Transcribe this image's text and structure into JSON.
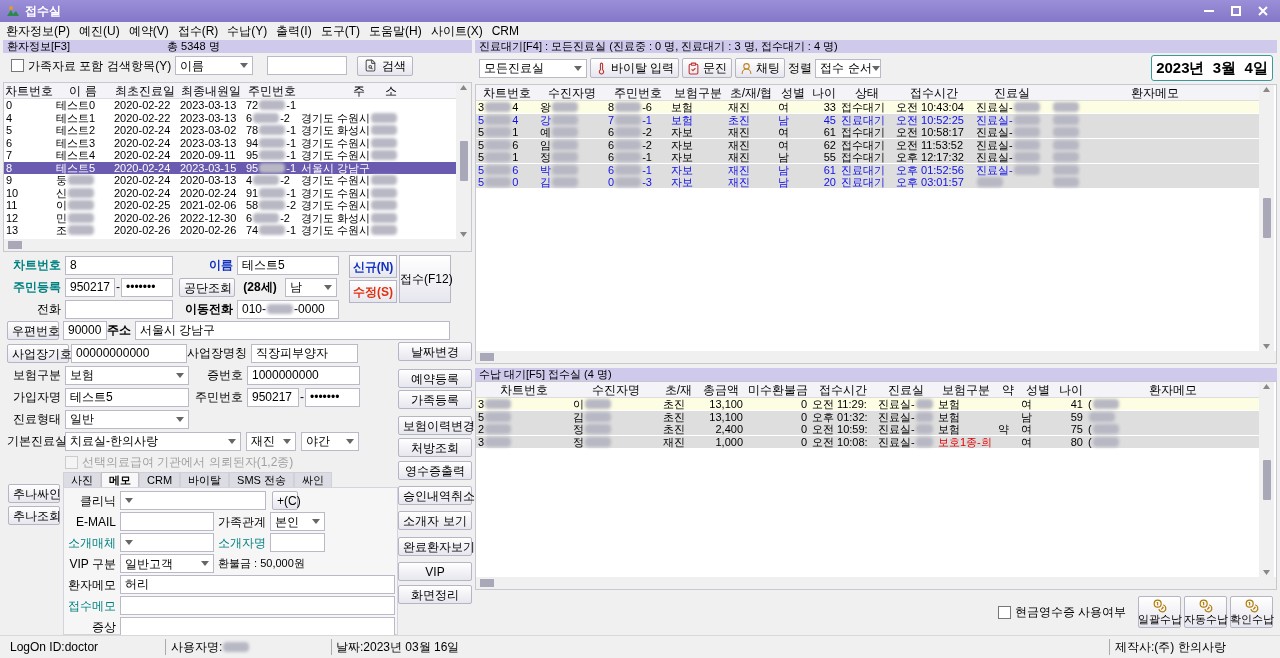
{
  "window": {
    "title": "접수실"
  },
  "menu": [
    "환자정보(P)",
    "예진(U)",
    "예약(V)",
    "접수(R)",
    "수납(Y)",
    "출력(I)",
    "도구(T)",
    "도움말(H)",
    "사이트(X)",
    "CRM"
  ],
  "patients": {
    "title": "환자정보[F3]",
    "total": "총 5348 명",
    "family_checkbox": {
      "label": "가족자료 포함",
      "checked": false
    },
    "search_label": "검색항목(Y)",
    "search_field": "이름",
    "search_button": "검색",
    "columns": [
      "차트번호",
      "이 름",
      "최초진료일",
      "최종내원일",
      "주민번호",
      "주      소"
    ],
    "rows": [
      {
        "cells": [
          "0",
          "테스트0",
          "2020-02-22",
          "2023-03-13",
          [
            "72",
            {
              "kind": "blur"
            },
            "-1"
          ]
        ],
        "selected": false
      },
      {
        "cells": [
          "4",
          "테스트1",
          "2020-02-22",
          "2023-03-13",
          [
            "6",
            {
              "kind": "blur"
            },
            "-2"
          ],
          [
            "경기도 수원시",
            {
              "kind": "blur"
            }
          ]
        ],
        "selected": false
      },
      {
        "cells": [
          "5",
          "테스트2",
          "2020-02-24",
          "2023-03-02",
          [
            "78",
            {
              "kind": "blur"
            },
            "-1"
          ],
          [
            "경기도 화성시",
            {
              "kind": "blur"
            }
          ]
        ],
        "selected": false
      },
      {
        "cells": [
          "6",
          "테스트3",
          "2020-02-24",
          "2023-03-13",
          [
            "94",
            {
              "kind": "blur"
            },
            "-1"
          ],
          [
            "경기도 수원시",
            {
              "kind": "blur"
            }
          ]
        ],
        "selected": false
      },
      {
        "cells": [
          "7",
          "테스트4",
          "2020-02-24",
          "2020-09-11",
          [
            "95",
            {
              "kind": "blur"
            },
            "-1"
          ],
          [
            "경기도 수원시",
            {
              "kind": "blur"
            }
          ]
        ],
        "selected": false
      },
      {
        "cells": [
          "8",
          "테스트5",
          "2020-02-24",
          "2023-03-15",
          [
            "95",
            {
              "kind": "blur"
            },
            "-1"
          ],
          "서울시 강남구"
        ],
        "selected": true
      },
      {
        "cells": [
          "9",
          [
            "둥",
            {
              "kind": "blur"
            }
          ],
          "2020-02-24",
          "2020-03-13",
          [
            "4",
            {
              "kind": "blur"
            },
            "-2"
          ],
          [
            "경기도 수원시",
            {
              "kind": "blur"
            }
          ]
        ],
        "selected": false
      },
      {
        "cells": [
          "10",
          [
            "신",
            {
              "kind": "blur"
            }
          ],
          "2020-02-24",
          "2020-02-24",
          [
            "91",
            {
              "kind": "blur"
            },
            "-1"
          ],
          [
            "경기도 수원시",
            {
              "kind": "blur"
            }
          ]
        ],
        "selected": false
      },
      {
        "cells": [
          "11",
          [
            "이",
            {
              "kind": "blur"
            }
          ],
          "2020-02-25",
          "2021-02-06",
          [
            "58",
            {
              "kind": "blur"
            },
            "-2"
          ],
          [
            "경기도 수원시",
            {
              "kind": "blur"
            }
          ]
        ],
        "selected": false
      },
      {
        "cells": [
          "12",
          [
            "민",
            {
              "kind": "blur"
            }
          ],
          "2020-02-26",
          "2022-12-30",
          [
            "6",
            {
              "kind": "blur"
            },
            "-2"
          ],
          [
            "경기도 화성시",
            {
              "kind": "blur"
            }
          ]
        ],
        "selected": false
      },
      {
        "cells": [
          "13",
          [
            "조",
            {
              "kind": "blur"
            }
          ],
          "2020-02-26",
          "2020-02-26",
          [
            "74",
            {
              "kind": "blur"
            },
            "-1"
          ],
          [
            "경기도 수원시",
            {
              "kind": "blur"
            }
          ]
        ],
        "selected": false
      }
    ]
  },
  "form": {
    "chart_no": {
      "label": "차트번호",
      "value": "8"
    },
    "name": {
      "label": "이름",
      "value": "테스트5"
    },
    "new_button": "신규(N)",
    "edit_button": "수정(S)",
    "register_button": "접수(F12)",
    "rrn": {
      "label": "주민등록",
      "front": "950217",
      "separator": "-",
      "back": "•••••••"
    },
    "nhis_button": "공단조회",
    "age": "(28세)",
    "sex": "남",
    "phone": {
      "label": "전화"
    },
    "mobile": {
      "label": "이동전화",
      "value": [
        "010-",
        {
          "kind": "blur"
        },
        "-0000"
      ]
    },
    "zip_button": "우편번호",
    "zip": "90000",
    "address": {
      "label": "주소",
      "value": "서울시 강남구"
    },
    "workplace_button": "사업장기호",
    "workplace_no": "00000000000",
    "workplace_name": {
      "label": "사업장명칭",
      "value": "직장피부양자"
    },
    "insurance": {
      "label": "보험구분",
      "value": "보험"
    },
    "card_no": {
      "label": "증번호",
      "value": "1000000000"
    },
    "subscriber": {
      "label": "가입자명",
      "value": "테스트5"
    },
    "subscriber_rrn": {
      "label": "주민번호",
      "front": "950217",
      "separator": "-",
      "back": "•••••••"
    },
    "care_type": {
      "label": "진료형태",
      "value": "일반"
    },
    "room": {
      "label": "기본진료실",
      "value": "치료실-한의사랑",
      "visit": "재진",
      "time": "야간"
    },
    "referral_check": {
      "label": "선택의료급여 기관에서 의뢰된자(1,2종)",
      "checked": false,
      "disabled": true
    },
    "tabs": [
      {
        "label": "사진",
        "selected": false
      },
      {
        "label": "메모",
        "selected": true
      },
      {
        "label": "CRM",
        "selected": false
      },
      {
        "label": "바이탈",
        "selected": false
      },
      {
        "label": "SMS 전송",
        "selected": false
      },
      {
        "label": "싸인",
        "selected": false
      }
    ],
    "side_buttons": [
      "추나싸인",
      "추나조회"
    ],
    "memo": {
      "clinic": {
        "label": "클리닉"
      },
      "clinic_add": "+(C)",
      "email": {
        "label": "E-MAIL"
      },
      "family": {
        "label": "가족관계",
        "value": "본인"
      },
      "media": {
        "label": "소개매체"
      },
      "referrer": {
        "label": "소개자명"
      },
      "vip": {
        "label": "VIP 구분",
        "value": "일반고객"
      },
      "refund": "환불금 : 50,000원",
      "patient_memo": {
        "label": "환자메모",
        "value": "허리"
      },
      "reception_memo": {
        "label": "접수메모"
      },
      "symptom": {
        "label": "증상"
      }
    },
    "action_buttons": [
      "날짜변경",
      "예약등록",
      "가족등록",
      "보험이력변경",
      "처방조회",
      "영수증출력",
      "승인내역취소",
      "소개자 보기",
      "완료환자보기",
      "VIP",
      "화면정리"
    ]
  },
  "waiting": {
    "title": "진료대기[F4] : 모든진료실 (진료중 : 0 명, 진료대기 : 3 명, 접수대기 : 4 명)",
    "room_select": "모든진료실",
    "tool_buttons": [
      {
        "kind": "vital",
        "label": "바이탈 입력"
      },
      {
        "kind": "interview",
        "label": "문진"
      },
      {
        "kind": "chat",
        "label": "채팅"
      }
    ],
    "sort_label": "정렬",
    "sort_select": "접수 순서",
    "date": "2023년  3월  4일",
    "columns": [
      "차트번호",
      "수진자명",
      "주민번호",
      "보험구분",
      "초/재/협",
      "성별",
      "나이",
      "상태",
      "접수시간",
      "진료실",
      "환자메모"
    ],
    "rows": [
      {
        "cells": [
          [
            "3",
            {
              "kind": "blur"
            },
            "4"
          ],
          [
            "왕",
            {
              "kind": "blur"
            }
          ],
          [
            "8",
            {
              "kind": "blur"
            },
            "-6"
          ],
          "보험",
          "재진",
          "여",
          "33",
          "접수대기",
          "오전 10:43:04",
          [
            "진료실-",
            {
              "kind": "blur"
            }
          ],
          [
            {
              "kind": "blur"
            }
          ]
        ],
        "selected": true,
        "kind": "reception"
      },
      {
        "cells": [
          [
            "5",
            {
              "kind": "blur"
            },
            "4"
          ],
          [
            "강",
            {
              "kind": "blur"
            }
          ],
          [
            "7",
            {
              "kind": "blur"
            },
            "-1"
          ],
          "보험",
          "초진",
          "남",
          "45",
          "진료대기",
          "오전 10:52:25",
          [
            "진료실-",
            {
              "kind": "blur"
            }
          ],
          [
            {
              "kind": "blur"
            }
          ]
        ],
        "selected": false,
        "kind": "treatment"
      },
      {
        "cells": [
          [
            "5",
            {
              "kind": "blur"
            },
            "1"
          ],
          [
            "예",
            {
              "kind": "blur"
            }
          ],
          [
            "6",
            {
              "kind": "blur"
            },
            "-2"
          ],
          "자보",
          "재진",
          "여",
          "61",
          "접수대기",
          "오전 10:58:17",
          [
            "진료실-",
            {
              "kind": "blur"
            }
          ],
          [
            {
              "kind": "blur"
            }
          ]
        ],
        "selected": false,
        "kind": "reception"
      },
      {
        "cells": [
          [
            "5",
            {
              "kind": "blur"
            },
            "6"
          ],
          [
            "임",
            {
              "kind": "blur"
            }
          ],
          [
            "6",
            {
              "kind": "blur"
            },
            "-2"
          ],
          "자보",
          "재진",
          "여",
          "62",
          "접수대기",
          "오전 11:53:52",
          [
            "진료실-",
            {
              "kind": "blur"
            }
          ],
          [
            {
              "kind": "blur"
            }
          ]
        ],
        "selected": false,
        "kind": "reception"
      },
      {
        "cells": [
          [
            "5",
            {
              "kind": "blur"
            },
            "1"
          ],
          [
            "정",
            {
              "kind": "blur"
            }
          ],
          [
            "6",
            {
              "kind": "blur"
            },
            "-1"
          ],
          "자보",
          "재진",
          "남",
          "55",
          "접수대기",
          "오후 12:17:32",
          [
            "진료실-",
            {
              "kind": "blur"
            }
          ],
          [
            {
              "kind": "blur"
            }
          ]
        ],
        "selected": false,
        "kind": "reception"
      },
      {
        "cells": [
          [
            "5",
            {
              "kind": "blur"
            },
            "6"
          ],
          [
            "박",
            {
              "kind": "blur"
            }
          ],
          [
            "6",
            {
              "kind": "blur"
            },
            "-1"
          ],
          "자보",
          "재진",
          "남",
          "61",
          "진료대기",
          "오후 01:52:56",
          [
            "진료실-",
            {
              "kind": "blur"
            }
          ],
          [
            {
              "kind": "blur"
            }
          ]
        ],
        "selected": false,
        "kind": "treatment"
      },
      {
        "cells": [
          [
            "5",
            {
              "kind": "blur"
            },
            "0"
          ],
          [
            "김",
            {
              "kind": "blur"
            }
          ],
          [
            "0",
            {
              "kind": "blur"
            },
            "-3"
          ],
          "자보",
          "재진",
          "남",
          "20",
          "진료대기",
          "오후 03:01:57",
          [
            {
              "kind": "blur"
            }
          ],
          [
            {
              "kind": "blur"
            }
          ]
        ],
        "selected": false,
        "kind": "treatment"
      }
    ]
  },
  "payment": {
    "title": "수납 대기[F5] 접수실 (4 명)",
    "columns": [
      "차트번호",
      "수진자명",
      "초/재",
      "총금액",
      "미수환불금",
      "접수시간",
      "진료실",
      "보험구분",
      "약",
      "성별",
      "나이",
      "환자메모"
    ],
    "rows": [
      {
        "cells": [
          [
            "3",
            {
              "kind": "blur"
            }
          ],
          [
            "이",
            {
              "kind": "blur"
            }
          ],
          "초진",
          "13,100",
          "0",
          "오전 11:29:",
          [
            "진료실-",
            {
              "kind": "blur"
            }
          ],
          "보험",
          "",
          "여",
          "41",
          [
            "(",
            {
              "kind": "blur"
            }
          ]
        ],
        "selected": true,
        "warn": false
      },
      {
        "cells": [
          [
            "5",
            {
              "kind": "blur"
            }
          ],
          [
            "김",
            {
              "kind": "blur"
            }
          ],
          "초진",
          "13,100",
          "0",
          "오후 01:32:",
          [
            "진료실-",
            {
              "kind": "blur"
            }
          ],
          "보험",
          "",
          "남",
          "59",
          [
            {
              "kind": "blur"
            }
          ]
        ],
        "selected": false,
        "warn": false
      },
      {
        "cells": [
          [
            "2",
            {
              "kind": "blur"
            }
          ],
          [
            "정",
            {
              "kind": "blur"
            }
          ],
          "초진",
          "2,400",
          "0",
          "오전 10:59:",
          [
            "진료실-",
            {
              "kind": "blur"
            }
          ],
          "보험",
          "약",
          "여",
          "75",
          [
            "(",
            {
              "kind": "blur"
            }
          ]
        ],
        "selected": false,
        "warn": false
      },
      {
        "cells": [
          [
            "3",
            {
              "kind": "blur"
            }
          ],
          [
            "정",
            {
              "kind": "blur"
            }
          ],
          "재진",
          "1,000",
          "0",
          "오전 10:08:",
          [
            "진료실-",
            {
              "kind": "blur"
            }
          ],
          "보호1종-희",
          "",
          "여",
          "80",
          [
            "(",
            {
              "kind": "blur"
            }
          ]
        ],
        "selected": false,
        "warn": true
      }
    ],
    "cash_receipt": {
      "label": "현금영수증 사용여부",
      "checked": false
    },
    "buttons": [
      "일괄수납",
      "자동수납",
      "확인수납"
    ]
  },
  "status_bar": {
    "logon": "LogOn ID:doctor",
    "user": [
      "사용자명:",
      {
        "kind": "blur"
      }
    ],
    "date": "날짜:2023년 03월 16일",
    "maker": "제작사:(주) 한의사랑"
  }
}
